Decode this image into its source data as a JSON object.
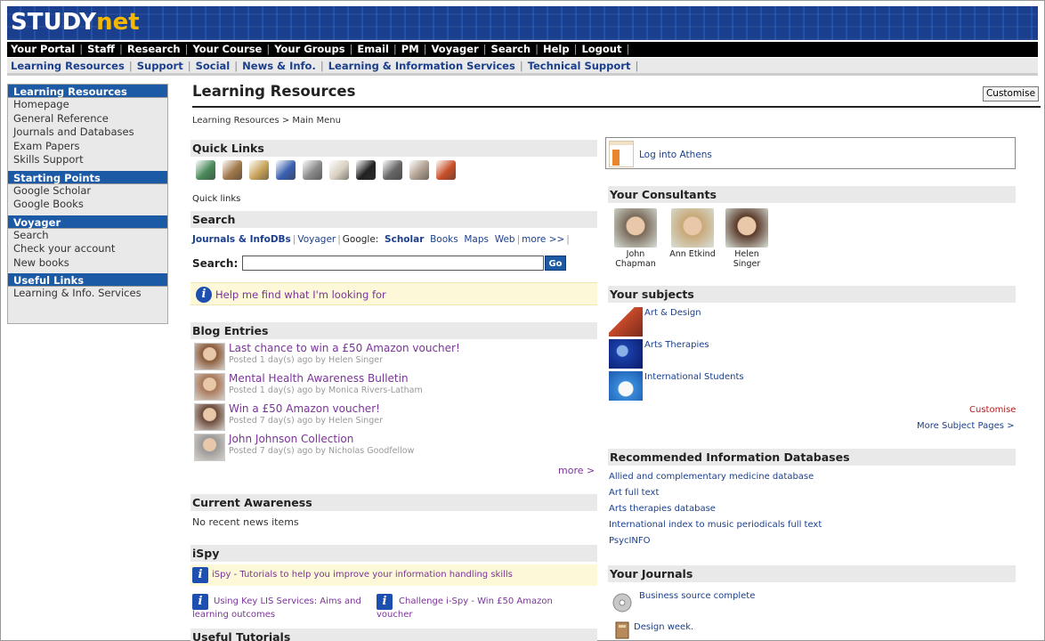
{
  "brand": {
    "logo_main": "STUDY",
    "logo_accent": "net"
  },
  "topnav": [
    "Your Portal",
    "Staff",
    "Research",
    "Your Course",
    "Your Groups",
    "Email",
    "PM",
    "Voyager",
    "Search",
    "Help",
    "Logout"
  ],
  "subnav": [
    "Learning Resources",
    "Support",
    "Social",
    "News & Info.",
    "Learning & Information Services",
    "Technical Support"
  ],
  "sidebar": {
    "sections": [
      {
        "title": "Learning Resources",
        "items": [
          "Homepage",
          "General Reference",
          "Journals and Databases",
          "Exam Papers",
          "Skills Support"
        ]
      },
      {
        "title": "Starting Points",
        "items": [
          "Google Scholar",
          "Google Books"
        ]
      },
      {
        "title": "Voyager",
        "items": [
          "Search",
          "Check your account",
          "New books"
        ]
      },
      {
        "title": "Useful Links",
        "items": [
          "Learning & Info. Services"
        ]
      }
    ]
  },
  "main": {
    "title": "Learning Resources",
    "customise_button": "Customise",
    "breadcrumb": "Learning Resources > Main Menu",
    "quick_links": {
      "heading": "Quick Links",
      "caption": "Quick links",
      "icons": [
        {
          "name": "books-icon",
          "color": "#4a8a5a"
        },
        {
          "name": "bag-icon",
          "color": "#a0784a"
        },
        {
          "name": "hand-book-icon",
          "color": "#c9a35a"
        },
        {
          "name": "blue-book-icon",
          "color": "#3a5fb0"
        },
        {
          "name": "pen-icon",
          "color": "#8a8a8a"
        },
        {
          "name": "open-book-icon",
          "color": "#d8d0c0"
        },
        {
          "name": "binoculars-icon",
          "color": "#222222"
        },
        {
          "name": "computer-icon",
          "color": "#666666"
        },
        {
          "name": "people-icon",
          "color": "#b0a090"
        },
        {
          "name": "box-icon",
          "color": "#c8502a"
        }
      ]
    },
    "search": {
      "heading": "Search",
      "tab_bold": "Journals & InfoDBs",
      "tab_voyager": "Voyager",
      "google_label": "Google:",
      "google_scholar": "Scholar",
      "google_books": "Books",
      "google_maps": "Maps",
      "google_web": "Web",
      "more": "more >>",
      "label": "Search:",
      "input_value": "",
      "go": "Go"
    },
    "help": "Help me find what I'm looking for",
    "blog": {
      "heading": "Blog Entries",
      "entries": [
        {
          "title": "Last chance to win a £50 Amazon voucher!",
          "meta": "Posted 1 day(s) ago by Helen Singer"
        },
        {
          "title": "Mental Health Awareness Bulletin",
          "meta": "Posted 1 day(s) ago by Monica Rivers-Latham"
        },
        {
          "title": "Win a £50 Amazon voucher!",
          "meta": "Posted 7 day(s) ago by Helen Singer"
        },
        {
          "title": "John Johnson Collection",
          "meta": "Posted 7 day(s) ago by Nicholas Goodfellow"
        }
      ],
      "more": "more >"
    },
    "current_awareness": {
      "heading": "Current Awareness",
      "text": "No recent news items"
    },
    "ispy": {
      "heading": "iSpy",
      "banner": "iSpy - Tutorials to help you improve your information handling skills",
      "item1_line1": "Using Key LIS Services: Aims and",
      "item1_line2": "learning outcomes",
      "item2_line1": "Challenge i-Spy - Win £50 Amazon",
      "item2_line2": "voucher"
    },
    "useful_tutorials": {
      "heading": "Useful Tutorials"
    }
  },
  "right": {
    "athens": "Log into Athens",
    "consultants": {
      "heading": "Your Consultants",
      "people": [
        {
          "line1": "John",
          "line2": "Chapman"
        },
        {
          "line1": "Ann Etkind",
          "line2": ""
        },
        {
          "line1": "Helen",
          "line2": "Singer"
        }
      ]
    },
    "subjects": {
      "heading": "Your subjects",
      "items": [
        "Art & Design",
        "Arts Therapies",
        "International Students"
      ],
      "customise": "Customise",
      "more": "More Subject Pages >"
    },
    "databases": {
      "heading": "Recommended Information Databases",
      "items": [
        "Allied and complementary medicine database",
        "Art full text",
        "Arts therapies database",
        "International index to music periodicals full text",
        "PsycINFO"
      ]
    },
    "journals": {
      "heading": "Your Journals",
      "items": [
        "Business source complete",
        "Design week."
      ]
    }
  }
}
